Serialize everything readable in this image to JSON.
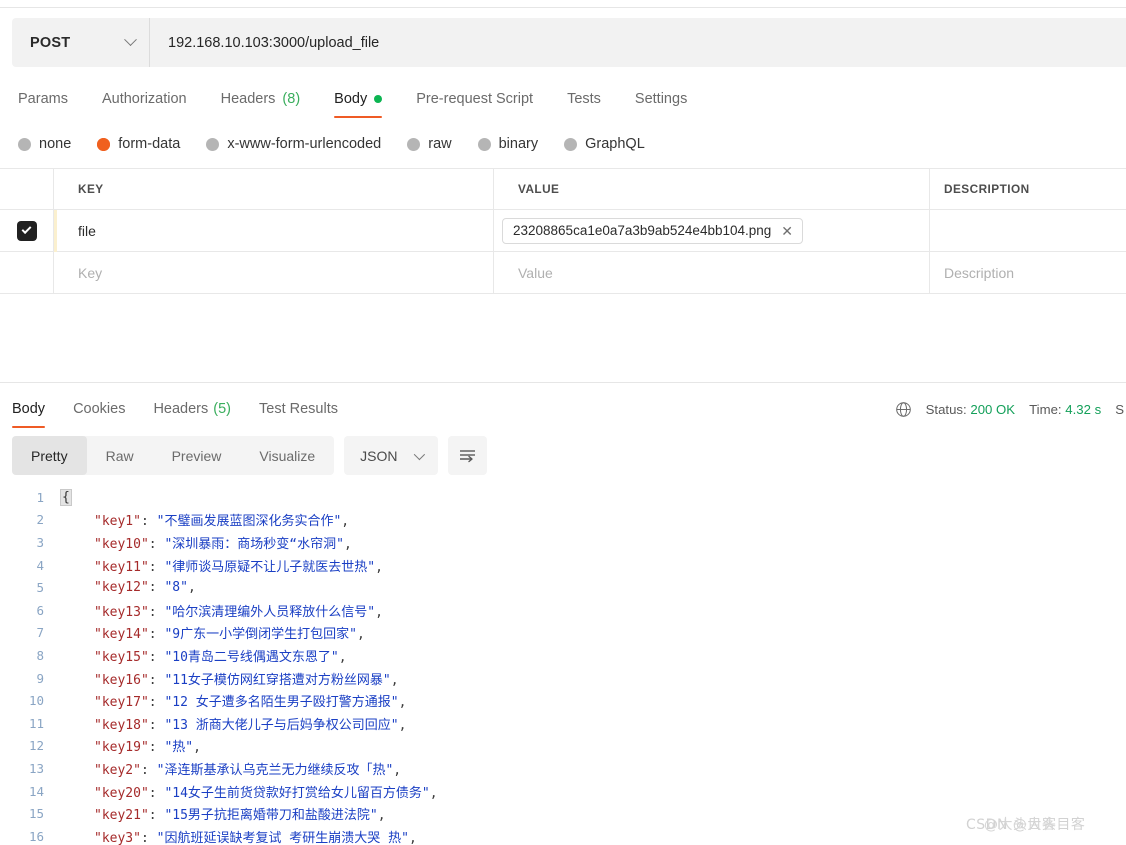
{
  "request": {
    "method": "POST",
    "url": "192.168.10.103:3000/upload_file",
    "tabs": [
      {
        "label": "Params",
        "count": "",
        "active": false,
        "dot": false
      },
      {
        "label": "Authorization",
        "count": "",
        "active": false,
        "dot": false
      },
      {
        "label": "Headers",
        "count": "(8)",
        "active": false,
        "dot": false
      },
      {
        "label": "Body",
        "count": "",
        "active": true,
        "dot": true
      },
      {
        "label": "Pre-request Script",
        "count": "",
        "active": false,
        "dot": false
      },
      {
        "label": "Tests",
        "count": "",
        "active": false,
        "dot": false
      },
      {
        "label": "Settings",
        "count": "",
        "active": false,
        "dot": false
      }
    ],
    "body_types": [
      {
        "label": "none",
        "selected": false
      },
      {
        "label": "form-data",
        "selected": true
      },
      {
        "label": "x-www-form-urlencoded",
        "selected": false
      },
      {
        "label": "raw",
        "selected": false
      },
      {
        "label": "binary",
        "selected": false
      },
      {
        "label": "GraphQL",
        "selected": false
      }
    ],
    "form_data": {
      "columns": [
        "KEY",
        "VALUE",
        "DESCRIPTION"
      ],
      "rows": [
        {
          "checked": true,
          "key": "file",
          "value": "23208865ca1e0a7a3b9ab524e4bb104.png",
          "value_is_file": true,
          "description": ""
        }
      ],
      "placeholders": {
        "key": "Key",
        "value": "Value",
        "description": "Description"
      }
    }
  },
  "response": {
    "tabs": [
      {
        "label": "Body",
        "count": "",
        "active": true
      },
      {
        "label": "Cookies",
        "count": "",
        "active": false
      },
      {
        "label": "Headers",
        "count": "(5)",
        "active": false
      },
      {
        "label": "Test Results",
        "count": "",
        "active": false
      }
    ],
    "meta": {
      "status_label": "Status:",
      "status_value": "200 OK",
      "time_label": "Time:",
      "time_value": "4.32 s",
      "size_label": "S"
    },
    "view_modes": [
      {
        "label": "Pretty",
        "active": true
      },
      {
        "label": "Raw",
        "active": false
      },
      {
        "label": "Preview",
        "active": false
      },
      {
        "label": "Visualize",
        "active": false
      }
    ],
    "format": "JSON",
    "code_lines": [
      {
        "n": "1",
        "type": "brace",
        "text": "{"
      },
      {
        "n": "2",
        "type": "pair",
        "key": "\"key1\"",
        "value": "\"不璧画发展蓝图深化务实合作\"",
        "comma": ","
      },
      {
        "n": "3",
        "type": "pair",
        "key": "\"key10\"",
        "value": "\"深圳暴雨：商场秒变“水帘洞\"",
        "comma": ","
      },
      {
        "n": "4",
        "type": "pair",
        "key": "\"key11\"",
        "value": "\"律师谈马原疑不让儿子就医去世热\"",
        "comma": ","
      },
      {
        "n": "5",
        "type": "pair",
        "key": "\"key12\"",
        "value": "\"8\"",
        "comma": ","
      },
      {
        "n": "6",
        "type": "pair",
        "key": "\"key13\"",
        "value": "\"哈尔滨清理编外人员释放什么信号\"",
        "comma": ","
      },
      {
        "n": "7",
        "type": "pair",
        "key": "\"key14\"",
        "value": "\"9广东一小学倒闭学生打包回家\"",
        "comma": ","
      },
      {
        "n": "8",
        "type": "pair",
        "key": "\"key15\"",
        "value": "\"10青岛二号线偶遇文东恩了\"",
        "comma": ","
      },
      {
        "n": "9",
        "type": "pair",
        "key": "\"key16\"",
        "value": "\"11女子模仿网红穿搭遭对方粉丝网暴\"",
        "comma": ","
      },
      {
        "n": "10",
        "type": "pair",
        "key": "\"key17\"",
        "value": "\"12 女子遭多名陌生男子殴打警方通报\"",
        "comma": ","
      },
      {
        "n": "11",
        "type": "pair",
        "key": "\"key18\"",
        "value": "\"13 浙商大佬儿子与后妈争权公司回应\"",
        "comma": ","
      },
      {
        "n": "12",
        "type": "pair",
        "key": "\"key19\"",
        "value": "\"热\"",
        "comma": ","
      },
      {
        "n": "13",
        "type": "pair",
        "key": "\"key2\"",
        "value": "\"泽连斯基承认乌克兰无力继续反攻「热\"",
        "comma": ","
      },
      {
        "n": "14",
        "type": "pair",
        "key": "\"key20\"",
        "value": "\"14女子生前货贷款好打赏给女儿留百方债务\"",
        "comma": ","
      },
      {
        "n": "15",
        "type": "pair",
        "key": "\"key21\"",
        "value": "\"15男子抗拒离婚带刀和盐酸进法院\"",
        "comma": ","
      },
      {
        "n": "16",
        "type": "pair",
        "key": "\"key3\"",
        "value": "\"因航班延误缺考复试 考研生崩溃大哭 热\"",
        "comma": ","
      }
    ]
  },
  "watermark": {
    "text": "CSDN @大头目客",
    "overlay": "@大头目客"
  }
}
